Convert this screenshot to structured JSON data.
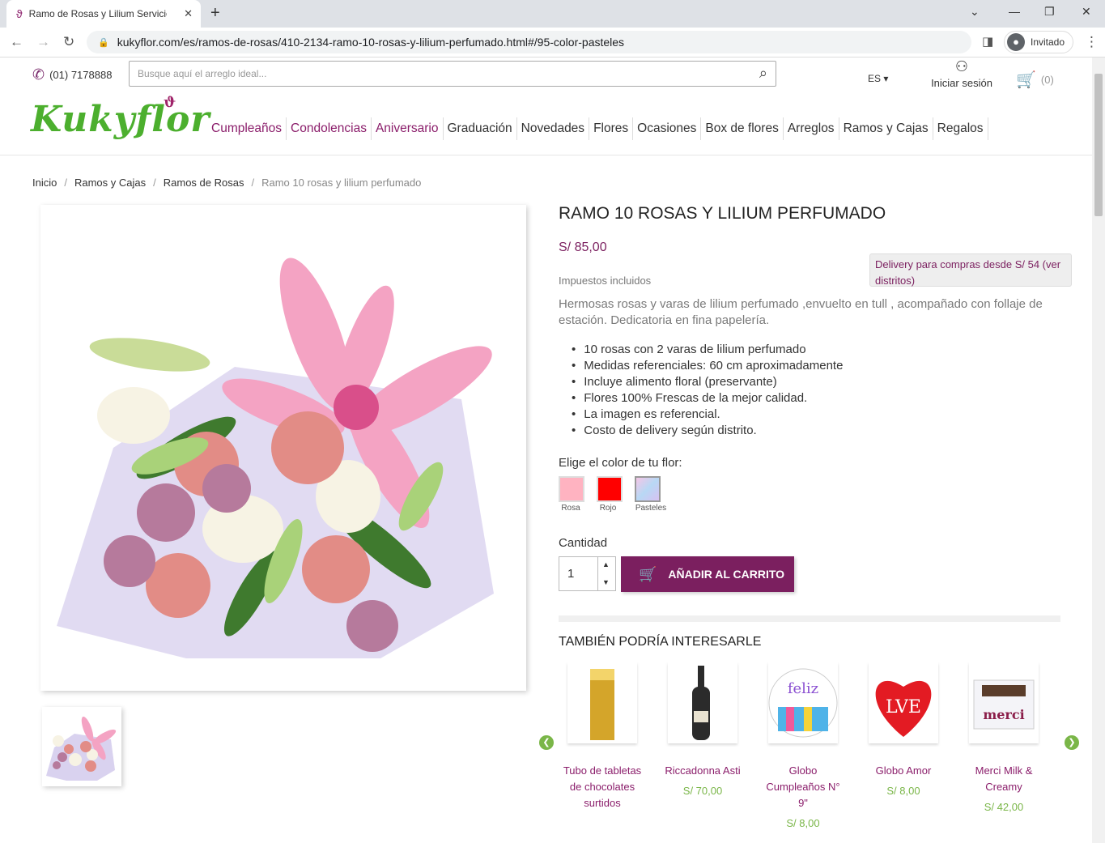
{
  "browser": {
    "tab_title": "Ramo de Rosas y Lilium Servicio",
    "url": "kukyflor.com/es/ramos-de-rosas/410-2134-ramo-10-rosas-y-lilium-perfumado.html#/95-color-pasteles",
    "profile": "Invitado"
  },
  "header": {
    "phone": "(01) 7178888",
    "search_placeholder": "Busque aquí el arreglo ideal...",
    "lang": "ES",
    "login": "Iniciar sesión",
    "cart_count": "(0)",
    "logo": "Kukyflor"
  },
  "nav": [
    "Cumpleaños",
    "Condolencias",
    "Aniversario",
    "Graduación",
    "Novedades",
    "Flores",
    "Ocasiones",
    "Box de flores",
    "Arreglos",
    "Ramos y Cajas",
    "Regalos"
  ],
  "breadcrumb": [
    "Inicio",
    "Ramos y Cajas",
    "Ramos de Rosas",
    "Ramo 10 rosas y lilium perfumado"
  ],
  "product": {
    "title": "RAMO 10 ROSAS Y LILIUM PERFUMADO",
    "price": "S/ 85,00",
    "tax": "Impuestos incluidos",
    "delivery": "Delivery para compras desde S/ 54 (ver distritos)",
    "description": "Hermosas rosas y varas de lilium perfumado ,envuelto en tull , acompañado con follaje de estación. Dedicatoria en fina papelería.",
    "features": [
      "10 rosas con 2 varas de lilium perfumado",
      "Medidas referenciales: 60 cm aproximadamente",
      "Incluye alimento floral (preservante)",
      "Flores 100% Frescas de la mejor calidad.",
      "La imagen es referencial.",
      "Costo de delivery según distrito."
    ],
    "color_label": "Elige el color de tu flor:",
    "colors": [
      {
        "label": "Rosa",
        "hex": "#ffb3c1"
      },
      {
        "label": "Rojo",
        "hex": "#ff0000"
      },
      {
        "label": "Pasteles",
        "hex": "#c9b8f0"
      }
    ],
    "qty_label": "Cantidad",
    "qty": "1",
    "add_to_cart": "AÑADIR AL CARRITO"
  },
  "related": {
    "title": "TAMBIÉN PODRÍA INTERESARLE",
    "items": [
      {
        "name": "Tubo de tabletas de chocolates surtidos",
        "price": ""
      },
      {
        "name": "Riccadonna Asti",
        "price": "S/ 70,00"
      },
      {
        "name": "Globo Cumpleaños N° 9\"",
        "price": "S/ 8,00"
      },
      {
        "name": "Globo Amor",
        "price": "S/ 8,00"
      },
      {
        "name": "Merci Milk & Creamy",
        "price": "S/ 42,00"
      }
    ]
  }
}
